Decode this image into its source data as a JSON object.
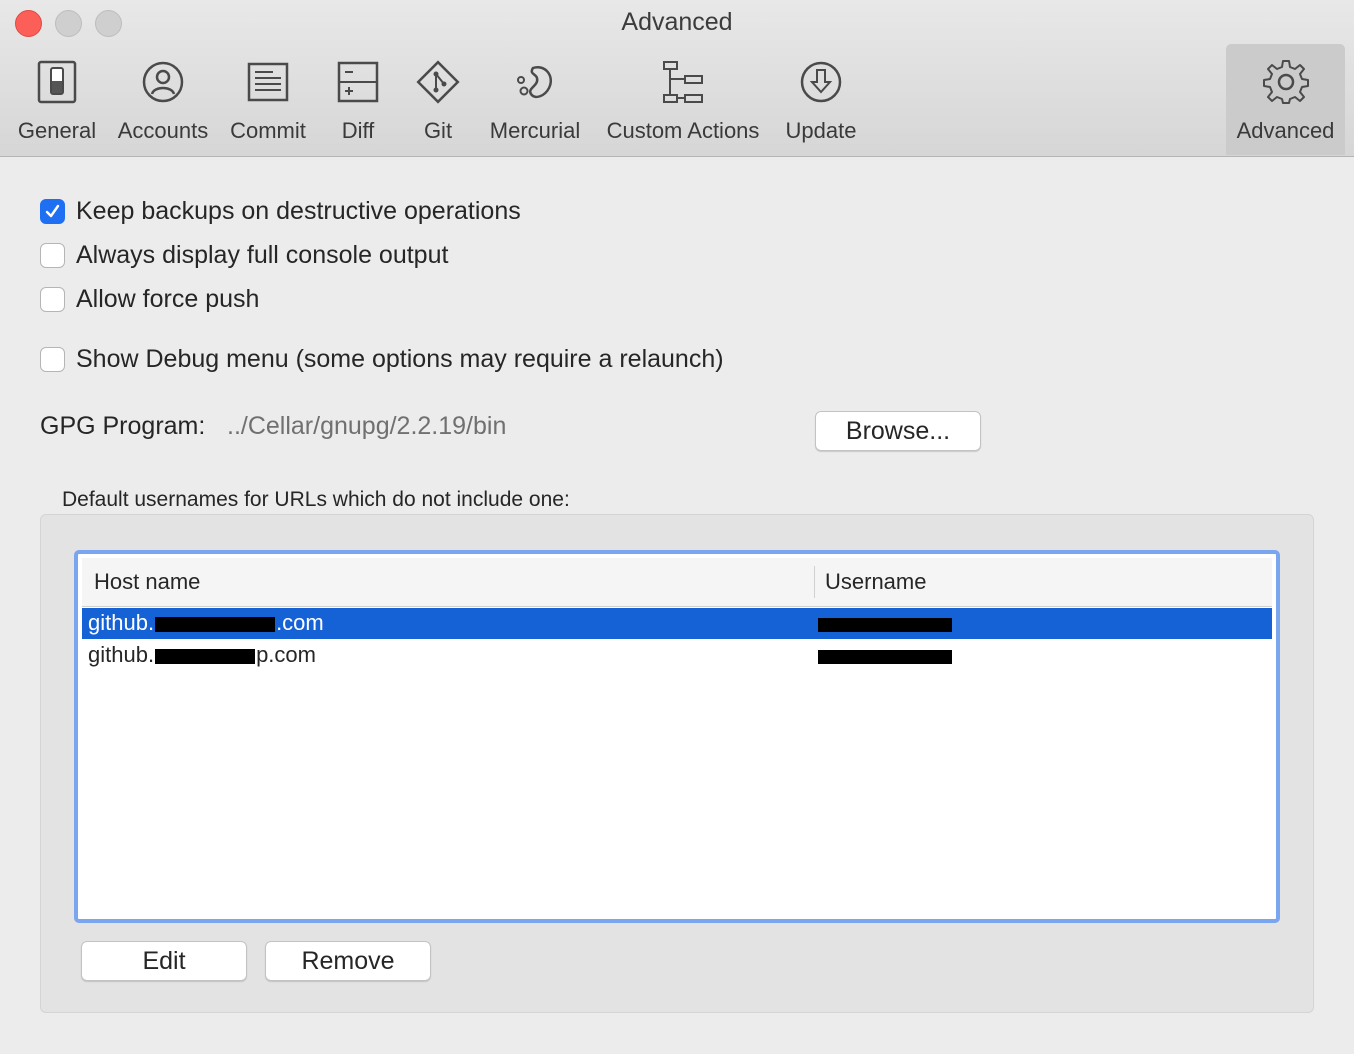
{
  "window": {
    "title": "Advanced"
  },
  "toolbar": {
    "items": [
      {
        "label": "General",
        "icon": "switch-icon"
      },
      {
        "label": "Accounts",
        "icon": "user-icon"
      },
      {
        "label": "Commit",
        "icon": "document-icon"
      },
      {
        "label": "Diff",
        "icon": "diff-icon"
      },
      {
        "label": "Git",
        "icon": "git-icon"
      },
      {
        "label": "Mercurial",
        "icon": "mercurial-icon"
      },
      {
        "label": "Custom Actions",
        "icon": "custom-actions-icon"
      },
      {
        "label": "Update",
        "icon": "download-icon"
      },
      {
        "label": "Advanced",
        "icon": "gear-icon",
        "selected": true
      }
    ]
  },
  "options": {
    "keep_backups": {
      "label": "Keep backups on destructive operations",
      "checked": true
    },
    "full_console": {
      "label": "Always display full console output",
      "checked": false
    },
    "force_push": {
      "label": "Allow force push",
      "checked": false
    },
    "debug_menu": {
      "label": "Show Debug menu (some options may require a relaunch)",
      "checked": false
    }
  },
  "gpg": {
    "label": "GPG Program:",
    "path": "../Cellar/gnupg/2.2.19/bin",
    "browse_label": "Browse..."
  },
  "usernames": {
    "caption": "Default usernames for URLs which do not include one:",
    "columns": {
      "host": "Host name",
      "username": "Username"
    },
    "rows": [
      {
        "host_prefix": "github.",
        "host_suffix": ".com",
        "selected": true
      },
      {
        "host_prefix": "github.",
        "host_suffix": "p.com",
        "selected": false
      }
    ],
    "edit_label": "Edit",
    "remove_label": "Remove"
  },
  "colors": {
    "accent": "#1f6ff3",
    "selection": "#1561d6",
    "focus_ring": "#7aa6f0"
  }
}
